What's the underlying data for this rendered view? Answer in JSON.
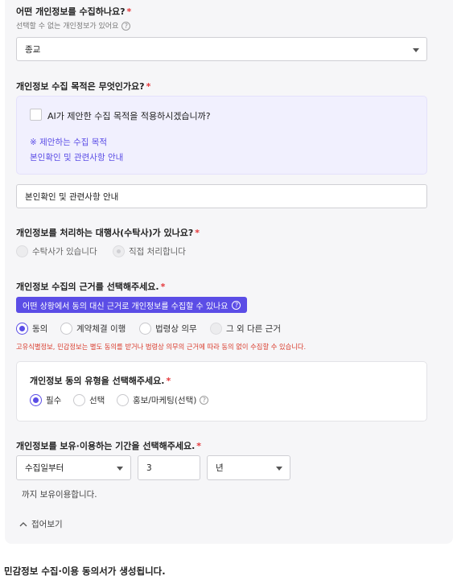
{
  "q1": {
    "title": "어떤 개인정보를 수집하나요?",
    "required_mark": "*",
    "hint": "선택할 수 없는 개인정보가 있어요",
    "select_value": "종교"
  },
  "q2": {
    "title": "개인정보 수집 목적은 무엇인가요?",
    "required_mark": "*",
    "suggest_checkbox_label": "AI가 제안한 수집 목적을 적용하시겠습니까?",
    "suggest_heading": "※ 제안하는 수집 목적",
    "suggest_item": "본인확인 및 관련사항 안내",
    "input_value": "본인확인 및 관련사항 안내"
  },
  "q3": {
    "title": "개인정보를 처리하는 대행사(수탁사)가 있나요?",
    "required_mark": "*",
    "options": [
      "수탁사가 있습니다",
      "직접 처리합니다"
    ]
  },
  "q4": {
    "title": "개인정보 수집의 근거를 선택해주세요.",
    "required_mark": "*",
    "banner": "어떤 상황에서 동의 대신 근거로 개인정보를 수집할 수 있나요",
    "options": [
      "동의",
      "계약체결 이행",
      "법령상 의무",
      "그 외 다른 근거"
    ],
    "warning": "고유식별정보, 민감정보는 별도 동의를 받거나 법령상 의무의 근거에 따라 동의 없이 수집할 수 있습니다.",
    "consent_type_title": "개인정보 동의 유형을 선택해주세요.",
    "consent_type_required_mark": "*",
    "consent_types": [
      "필수",
      "선택",
      "홍보/마케팅(선택)"
    ]
  },
  "q5": {
    "title": "개인정보를 보유·이용하는 기간을 선택해주세요.",
    "required_mark": "*",
    "start_value": "수집일부터",
    "amount_value": "3",
    "unit_value": "년",
    "suffix": "까지 보유이용합니다."
  },
  "collapse_label": "접어보기",
  "footer": "민감정보 수집·이용 동의서가 생성됩니다.",
  "colors": {
    "accent": "#5b4de6",
    "required": "#e5383b",
    "warning": "#d93a2b",
    "suggest_bg": "#f1f0fe"
  }
}
